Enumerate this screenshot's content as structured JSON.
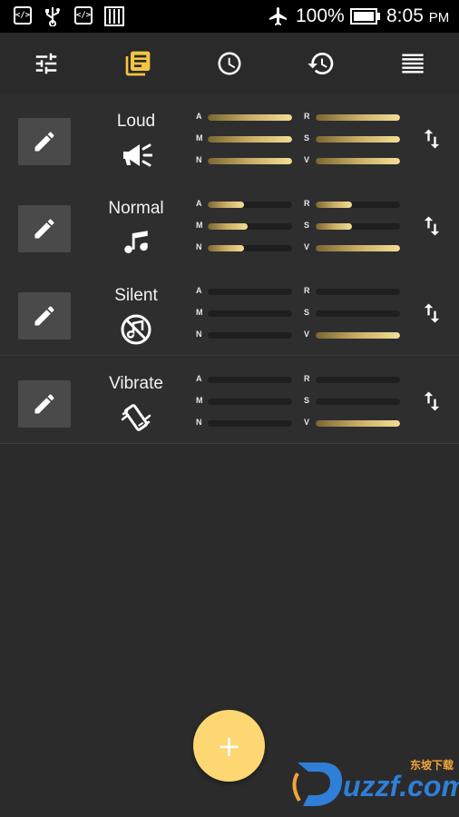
{
  "status_bar": {
    "battery_percent": "100%",
    "time": "8:05",
    "time_suffix": "PM",
    "left_icons": [
      "code-icon",
      "usb-icon",
      "code-icon",
      "sim-icon"
    ],
    "right_icons": [
      "airplane-mode-icon",
      "battery-icon"
    ]
  },
  "toolbar": {
    "tabs": [
      {
        "icon": "tune-icon",
        "active": false
      },
      {
        "icon": "library-books-icon",
        "active": true
      },
      {
        "icon": "clock-icon",
        "active": false
      },
      {
        "icon": "history-icon",
        "active": false
      },
      {
        "icon": "list-icon",
        "active": false
      }
    ],
    "active_color": "#f5c542"
  },
  "profiles": [
    {
      "name": "Loud",
      "icon": "megaphone-icon",
      "levels": [
        {
          "label": "A",
          "value": 1.0
        },
        {
          "label": "M",
          "value": 1.0
        },
        {
          "label": "N",
          "value": 1.0
        },
        {
          "label": "R",
          "value": 1.0
        },
        {
          "label": "S",
          "value": 1.0
        },
        {
          "label": "V",
          "value": 1.0
        }
      ]
    },
    {
      "name": "Normal",
      "icon": "music-note-icon",
      "levels": [
        {
          "label": "A",
          "value": 0.43
        },
        {
          "label": "M",
          "value": 0.47
        },
        {
          "label": "N",
          "value": 0.43
        },
        {
          "label": "R",
          "value": 0.43
        },
        {
          "label": "S",
          "value": 0.43
        },
        {
          "label": "V",
          "value": 1.0
        }
      ]
    },
    {
      "name": "Silent",
      "icon": "music-off-icon",
      "levels": [
        {
          "label": "A",
          "value": 0
        },
        {
          "label": "M",
          "value": 0
        },
        {
          "label": "N",
          "value": 0
        },
        {
          "label": "R",
          "value": 0
        },
        {
          "label": "S",
          "value": 0
        },
        {
          "label": "V",
          "value": 1.0
        }
      ]
    },
    {
      "name": "Vibrate",
      "icon": "vibrate-icon",
      "levels": [
        {
          "label": "A",
          "value": 0
        },
        {
          "label": "M",
          "value": 0
        },
        {
          "label": "N",
          "value": 0
        },
        {
          "label": "R",
          "value": 0
        },
        {
          "label": "S",
          "value": 0
        },
        {
          "label": "V",
          "value": 1.0
        }
      ]
    }
  ],
  "fab": {
    "label": "+",
    "color": "#fcd772"
  },
  "watermark": {
    "brand": "uzzf.com",
    "tagline": "东坡下载"
  }
}
